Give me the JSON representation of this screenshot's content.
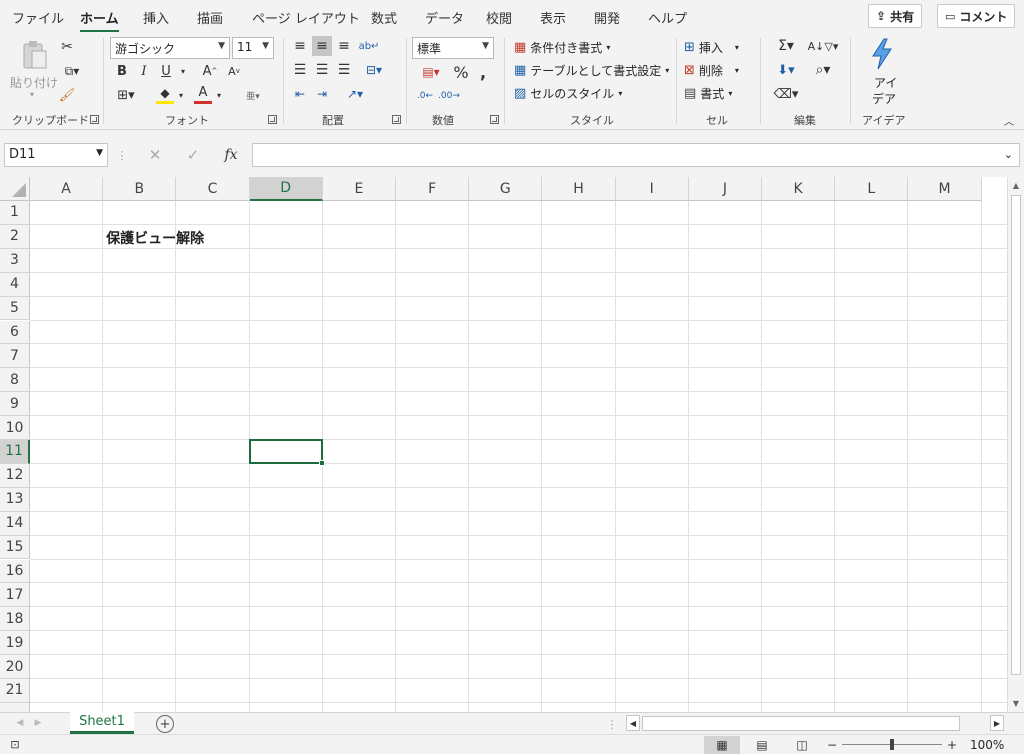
{
  "menu": {
    "tabs": [
      "ファイル",
      "ホーム",
      "挿入",
      "描画",
      "ページ レイアウト",
      "数式",
      "データ",
      "校閲",
      "表示",
      "開発",
      "ヘルプ"
    ],
    "active_tab": "ホーム",
    "share_label": "共有",
    "comment_label": "コメント"
  },
  "ribbon": {
    "clipboard": {
      "paste_label": "貼り付け",
      "group_label": "クリップボード"
    },
    "font": {
      "font_name": "游ゴシック",
      "font_size": "11",
      "group_label": "フォント",
      "bold": "B",
      "italic": "I",
      "underline": "U"
    },
    "alignment": {
      "group_label": "配置"
    },
    "number": {
      "format": "標準",
      "group_label": "数値"
    },
    "styles": {
      "conditional_label": "条件付き書式",
      "table_label": "テーブルとして書式設定",
      "cell_style_label": "セルのスタイル",
      "group_label": "スタイル"
    },
    "cells": {
      "insert_label": "挿入",
      "delete_label": "削除",
      "format_label": "書式",
      "group_label": "セル"
    },
    "editing": {
      "group_label": "編集"
    },
    "ideas": {
      "label_line1": "アイ",
      "label_line2": "デア",
      "group_label": "アイデア"
    }
  },
  "formula_bar": {
    "name_box": "D11",
    "fx_label": "fx",
    "formula": ""
  },
  "grid": {
    "columns": [
      "A",
      "B",
      "C",
      "D",
      "E",
      "F",
      "G",
      "H",
      "I",
      "J",
      "K",
      "L",
      "M"
    ],
    "rows": [
      "1",
      "2",
      "3",
      "4",
      "5",
      "6",
      "7",
      "8",
      "9",
      "10",
      "11",
      "12",
      "13",
      "14",
      "15",
      "16",
      "17",
      "18",
      "19",
      "20",
      "21"
    ],
    "selected_cell": "D11",
    "cells": {
      "B2": "保護ビュー解除"
    }
  },
  "sheets": {
    "tabs": [
      "Sheet1"
    ],
    "active": "Sheet1"
  },
  "status": {
    "zoom": "100%"
  },
  "colors": {
    "accent": "#217346",
    "selection": "#1e6b3e"
  }
}
